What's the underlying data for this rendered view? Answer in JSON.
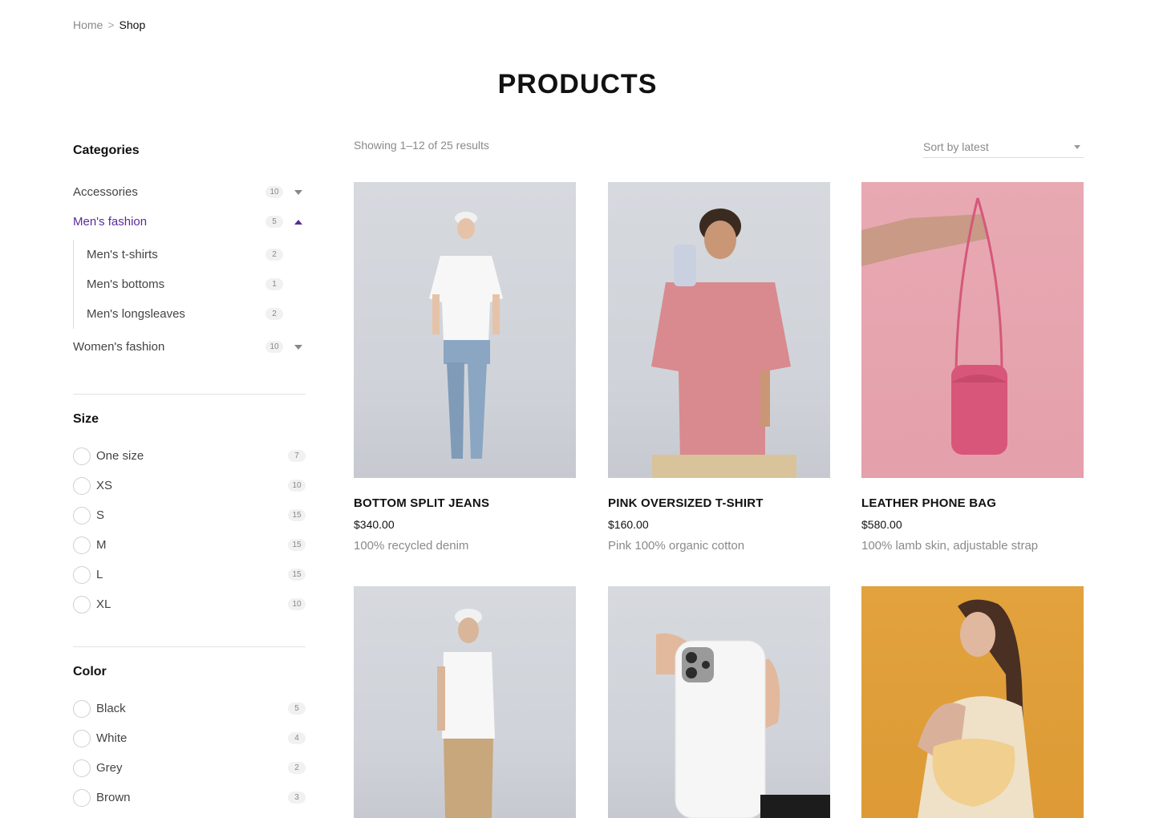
{
  "breadcrumb": {
    "home": "Home",
    "separator": ">",
    "current": "Shop"
  },
  "page_title": "PRODUCTS",
  "sidebar": {
    "categories": {
      "heading": "Categories",
      "items": [
        {
          "label": "Accessories",
          "count": "10",
          "expanded": false
        },
        {
          "label": "Men's fashion",
          "count": "5",
          "expanded": true,
          "children": [
            {
              "label": "Men's t-shirts",
              "count": "2"
            },
            {
              "label": "Men's bottoms",
              "count": "1"
            },
            {
              "label": "Men's longsleaves",
              "count": "2"
            }
          ]
        },
        {
          "label": "Women's fashion",
          "count": "10",
          "expanded": false
        }
      ]
    },
    "size": {
      "heading": "Size",
      "options": [
        {
          "label": "One size",
          "count": "7"
        },
        {
          "label": "XS",
          "count": "10"
        },
        {
          "label": "S",
          "count": "15"
        },
        {
          "label": "M",
          "count": "15"
        },
        {
          "label": "L",
          "count": "15"
        },
        {
          "label": "XL",
          "count": "10"
        }
      ]
    },
    "color": {
      "heading": "Color",
      "options": [
        {
          "label": "Black",
          "count": "5"
        },
        {
          "label": "White",
          "count": "4"
        },
        {
          "label": "Grey",
          "count": "2"
        },
        {
          "label": "Brown",
          "count": "3"
        }
      ]
    }
  },
  "toolbar": {
    "results_text": "Showing 1–12 of 25 results",
    "sort_label": "Sort by latest"
  },
  "products": [
    {
      "name": "BOTTOM SPLIT JEANS",
      "price": "$340.00",
      "description": "100% recycled denim"
    },
    {
      "name": "PINK OVERSIZED T-SHIRT",
      "price": "$160.00",
      "description": "Pink 100% organic cotton"
    },
    {
      "name": "LEATHER PHONE BAG",
      "price": "$580.00",
      "description": "100% lamb skin, adjustable strap"
    },
    {
      "name": "",
      "price": "",
      "description": ""
    },
    {
      "name": "",
      "price": "",
      "description": ""
    },
    {
      "name": "",
      "price": "",
      "description": ""
    }
  ],
  "colors": {
    "accent": "#5b2a99",
    "muted": "#8a8a8a",
    "text": "#111111"
  }
}
